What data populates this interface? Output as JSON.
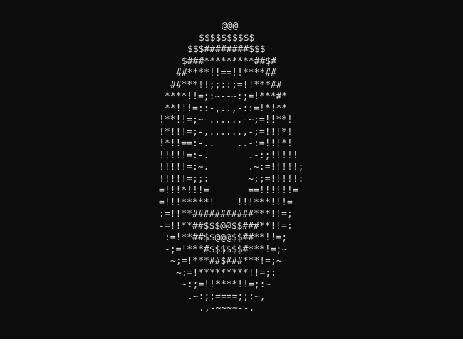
{
  "terminal": {
    "background": "#0c0c0c",
    "foreground": "#d4d4d4",
    "lines": [
      "@@@",
      "$$$$$$$$$$",
      "$$$########$$$",
      "$###*********##$#",
      "##****!!==!!****##",
      "##***!!;;::;=!!***##",
      "****!!=;:~--~:;=!***#*",
      "**!!!=::-,..,-::=!*!**",
      "!**!!=;~-......-~;=!!**!",
      "!*!!!=;-,......,-;=!!!*!",
      "!*!!==:-..    ..-:=!!!*!",
      "!!!!!=:-.       .-:;!!!!!",
      "!!!!!=:~.       .~:=!!!!!;",
      "!!!!!=;;:       ~;;=!!!!!:",
      "=!!!*!!!=       ==!!!!!!=",
      "=!!!*****!    !!!***!!!=",
      ":=!!**###########***!!=;",
      "-=!!**##$$$@@$$###**!!=:",
      ":=!**##$$@@@$$##**!!=;",
      "-;=!***#$$$$$$#***!=;~",
      "~;=!***##$###***!=;~",
      "~:=!*********!!=;:",
      "-:;=!!****!!=;:~",
      ".~:;;====;;:~,",
      ".,-~~~~--."
    ]
  }
}
